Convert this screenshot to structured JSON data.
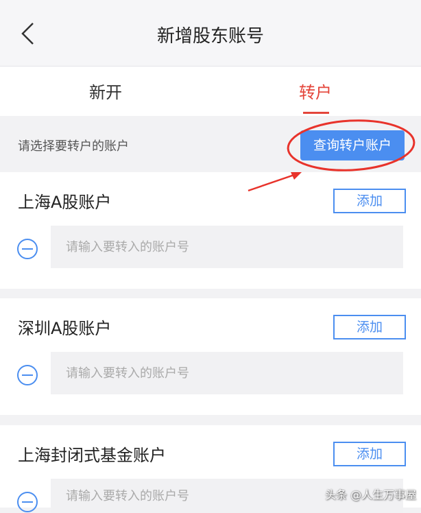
{
  "nav": {
    "title": "新增股东账号",
    "back_icon": "chevron-left-icon"
  },
  "tabs": [
    {
      "label": "新开",
      "active": false
    },
    {
      "label": "转户",
      "active": true
    }
  ],
  "notice": {
    "text": "请选择要转户的账户",
    "button_label": "查询转户账户"
  },
  "accounts": [
    {
      "title": "上海A股账户",
      "add_label": "添加",
      "input_placeholder": "请输入要转入的账户号",
      "input_value": ""
    },
    {
      "title": "深圳A股账户",
      "add_label": "添加",
      "input_placeholder": "请输入要转入的账户号",
      "input_value": ""
    },
    {
      "title": "上海封闭式基金账户",
      "add_label": "添加",
      "input_placeholder": "请输入要转入的账户号",
      "input_value": ""
    }
  ],
  "watermark": "头条 @人生万事屋",
  "colors": {
    "accent_blue": "#4b8ef0",
    "tab_active": "#e4453a",
    "annotation_red": "#e8332b"
  }
}
